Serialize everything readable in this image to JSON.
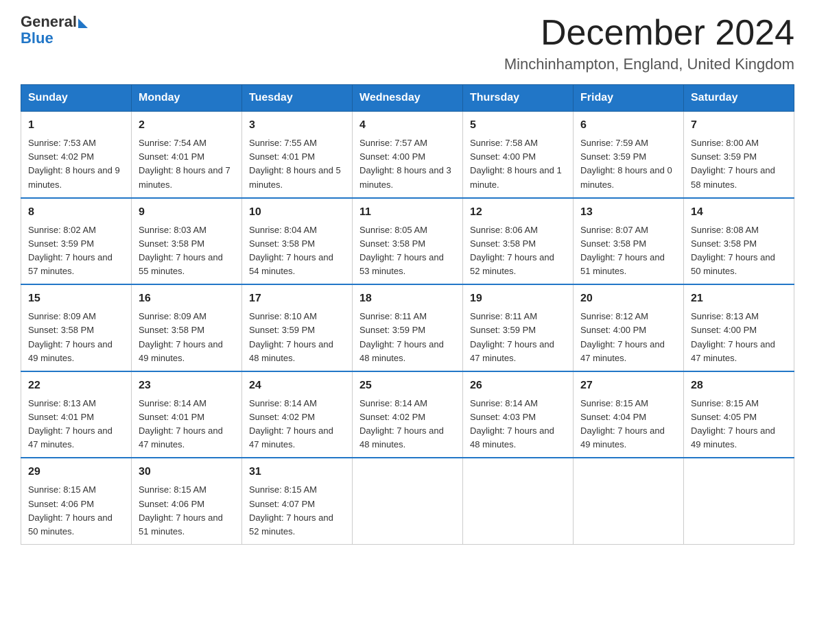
{
  "header": {
    "logo_general": "General",
    "logo_blue": "Blue",
    "month_year": "December 2024",
    "location": "Minchinhampton, England, United Kingdom"
  },
  "days_of_week": [
    "Sunday",
    "Monday",
    "Tuesday",
    "Wednesday",
    "Thursday",
    "Friday",
    "Saturday"
  ],
  "weeks": [
    [
      {
        "day": "1",
        "sunrise": "7:53 AM",
        "sunset": "4:02 PM",
        "daylight": "8 hours and 9 minutes."
      },
      {
        "day": "2",
        "sunrise": "7:54 AM",
        "sunset": "4:01 PM",
        "daylight": "8 hours and 7 minutes."
      },
      {
        "day": "3",
        "sunrise": "7:55 AM",
        "sunset": "4:01 PM",
        "daylight": "8 hours and 5 minutes."
      },
      {
        "day": "4",
        "sunrise": "7:57 AM",
        "sunset": "4:00 PM",
        "daylight": "8 hours and 3 minutes."
      },
      {
        "day": "5",
        "sunrise": "7:58 AM",
        "sunset": "4:00 PM",
        "daylight": "8 hours and 1 minute."
      },
      {
        "day": "6",
        "sunrise": "7:59 AM",
        "sunset": "3:59 PM",
        "daylight": "8 hours and 0 minutes."
      },
      {
        "day": "7",
        "sunrise": "8:00 AM",
        "sunset": "3:59 PM",
        "daylight": "7 hours and 58 minutes."
      }
    ],
    [
      {
        "day": "8",
        "sunrise": "8:02 AM",
        "sunset": "3:59 PM",
        "daylight": "7 hours and 57 minutes."
      },
      {
        "day": "9",
        "sunrise": "8:03 AM",
        "sunset": "3:58 PM",
        "daylight": "7 hours and 55 minutes."
      },
      {
        "day": "10",
        "sunrise": "8:04 AM",
        "sunset": "3:58 PM",
        "daylight": "7 hours and 54 minutes."
      },
      {
        "day": "11",
        "sunrise": "8:05 AM",
        "sunset": "3:58 PM",
        "daylight": "7 hours and 53 minutes."
      },
      {
        "day": "12",
        "sunrise": "8:06 AM",
        "sunset": "3:58 PM",
        "daylight": "7 hours and 52 minutes."
      },
      {
        "day": "13",
        "sunrise": "8:07 AM",
        "sunset": "3:58 PM",
        "daylight": "7 hours and 51 minutes."
      },
      {
        "day": "14",
        "sunrise": "8:08 AM",
        "sunset": "3:58 PM",
        "daylight": "7 hours and 50 minutes."
      }
    ],
    [
      {
        "day": "15",
        "sunrise": "8:09 AM",
        "sunset": "3:58 PM",
        "daylight": "7 hours and 49 minutes."
      },
      {
        "day": "16",
        "sunrise": "8:09 AM",
        "sunset": "3:58 PM",
        "daylight": "7 hours and 49 minutes."
      },
      {
        "day": "17",
        "sunrise": "8:10 AM",
        "sunset": "3:59 PM",
        "daylight": "7 hours and 48 minutes."
      },
      {
        "day": "18",
        "sunrise": "8:11 AM",
        "sunset": "3:59 PM",
        "daylight": "7 hours and 48 minutes."
      },
      {
        "day": "19",
        "sunrise": "8:11 AM",
        "sunset": "3:59 PM",
        "daylight": "7 hours and 47 minutes."
      },
      {
        "day": "20",
        "sunrise": "8:12 AM",
        "sunset": "4:00 PM",
        "daylight": "7 hours and 47 minutes."
      },
      {
        "day": "21",
        "sunrise": "8:13 AM",
        "sunset": "4:00 PM",
        "daylight": "7 hours and 47 minutes."
      }
    ],
    [
      {
        "day": "22",
        "sunrise": "8:13 AM",
        "sunset": "4:01 PM",
        "daylight": "7 hours and 47 minutes."
      },
      {
        "day": "23",
        "sunrise": "8:14 AM",
        "sunset": "4:01 PM",
        "daylight": "7 hours and 47 minutes."
      },
      {
        "day": "24",
        "sunrise": "8:14 AM",
        "sunset": "4:02 PM",
        "daylight": "7 hours and 47 minutes."
      },
      {
        "day": "25",
        "sunrise": "8:14 AM",
        "sunset": "4:02 PM",
        "daylight": "7 hours and 48 minutes."
      },
      {
        "day": "26",
        "sunrise": "8:14 AM",
        "sunset": "4:03 PM",
        "daylight": "7 hours and 48 minutes."
      },
      {
        "day": "27",
        "sunrise": "8:15 AM",
        "sunset": "4:04 PM",
        "daylight": "7 hours and 49 minutes."
      },
      {
        "day": "28",
        "sunrise": "8:15 AM",
        "sunset": "4:05 PM",
        "daylight": "7 hours and 49 minutes."
      }
    ],
    [
      {
        "day": "29",
        "sunrise": "8:15 AM",
        "sunset": "4:06 PM",
        "daylight": "7 hours and 50 minutes."
      },
      {
        "day": "30",
        "sunrise": "8:15 AM",
        "sunset": "4:06 PM",
        "daylight": "7 hours and 51 minutes."
      },
      {
        "day": "31",
        "sunrise": "8:15 AM",
        "sunset": "4:07 PM",
        "daylight": "7 hours and 52 minutes."
      },
      null,
      null,
      null,
      null
    ]
  ],
  "labels": {
    "sunrise_label": "Sunrise:",
    "sunset_label": "Sunset:",
    "daylight_label": "Daylight:"
  }
}
